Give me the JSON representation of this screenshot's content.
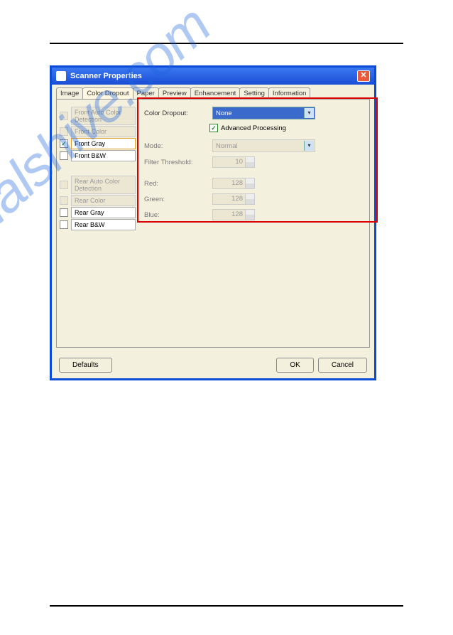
{
  "watermark": "manualshive.com",
  "dialog": {
    "title": "Scanner Properties",
    "tabs": [
      "Image",
      "Color Dropout",
      "Paper",
      "Preview",
      "Enhancement",
      "Setting",
      "Information"
    ],
    "activeTab": 1,
    "sidebar": {
      "front": [
        {
          "label": "Front Auto Color Detection",
          "checked": false,
          "enabled": false
        },
        {
          "label": "Front Color",
          "checked": false,
          "enabled": false
        },
        {
          "label": "Front Gray",
          "checked": true,
          "enabled": true,
          "selected": true
        },
        {
          "label": "Front B&W",
          "checked": false,
          "enabled": true
        }
      ],
      "rear": [
        {
          "label": "Rear Auto Color Detection",
          "checked": false,
          "enabled": false
        },
        {
          "label": "Rear Color",
          "checked": false,
          "enabled": false
        },
        {
          "label": "Rear Gray",
          "checked": false,
          "enabled": true
        },
        {
          "label": "Rear B&W",
          "checked": false,
          "enabled": true
        }
      ]
    },
    "form": {
      "colorDropoutLabel": "Color Dropout:",
      "colorDropoutValue": "None",
      "advancedProcessing": "Advanced Processing",
      "modeLabel": "Mode:",
      "modeValue": "Normal",
      "filterThresholdLabel": "Filter Threshold:",
      "filterThresholdValue": "10",
      "redLabel": "Red:",
      "redValue": "128",
      "greenLabel": "Green:",
      "greenValue": "128",
      "blueLabel": "Blue:",
      "blueValue": "128"
    },
    "buttons": {
      "defaults": "Defaults",
      "ok": "OK",
      "cancel": "Cancel"
    }
  }
}
